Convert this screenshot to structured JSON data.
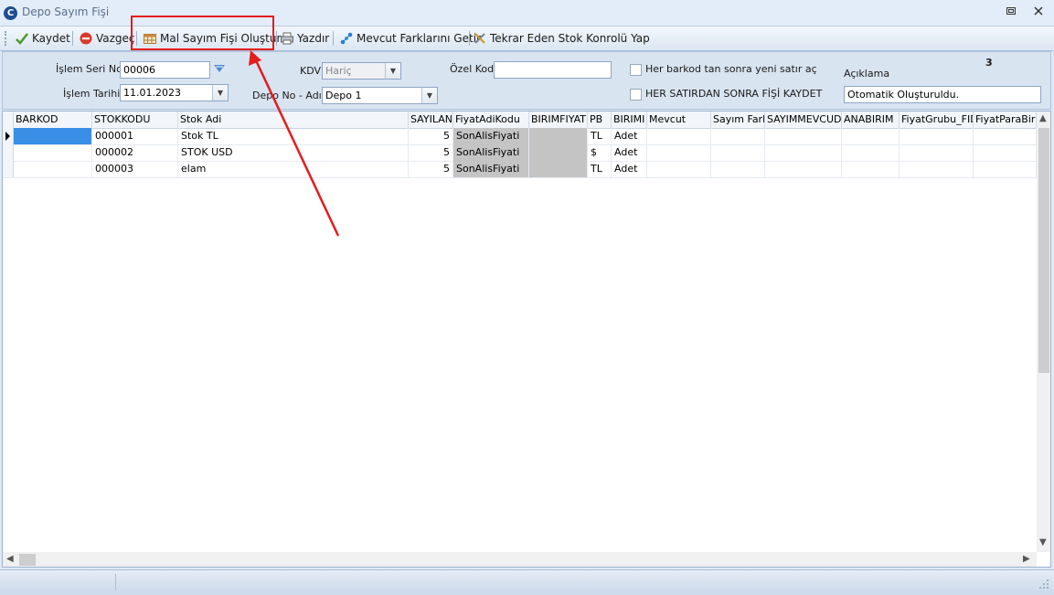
{
  "window": {
    "title": "Depo Sayım Fişi"
  },
  "toolbar": {
    "save_label": "Kaydet",
    "cancel_label": "Vazgeç",
    "create_slip_label": "Mal Sayım Fişi Oluştur",
    "print_label": "Yazdır",
    "fetch_diff_label": "Mevcut Farklarını Getir",
    "repeat_check_label": "Tekrar Eden Stok Konrolü Yap"
  },
  "form": {
    "seri_no_label": "İşlem Seri No",
    "seri_no_value": "00006",
    "tarih_label": "İşlem Tarihi",
    "tarih_value": "11.01.2023",
    "kdv_label": "KDV",
    "kdv_value": "Hariç",
    "depo_label": "Depo No - Adı",
    "depo_value": "Depo 1",
    "ozel_kod_label": "Özel Kod",
    "ozel_kod_value": "",
    "barkod_check_label": "Her barkod tan sonra yeni satır aç",
    "satir_check_label": "HER SATIRDAN SONRA FİŞİ KAYDET",
    "aciklama_label": "Açıklama",
    "aciklama_value": "Otomatik Oluşturuldu.",
    "count_value": "3"
  },
  "grid": {
    "columns": [
      "BARKOD",
      "STOKKODU",
      "Stok Adi",
      "SAYILAN",
      "FiyatAdiKodu",
      "BIRIMFIYAT",
      "PB",
      "BIRIMI",
      "Mevcut",
      "Sayım Farkı",
      "SAYIMMEVCUDU",
      "ANABIRIM",
      "FiyatGrubu_FID",
      "FiyatParaBirimi"
    ],
    "rows": [
      {
        "barkod": "",
        "stokkodu": "000001",
        "stokadi": "Stok TL",
        "sayilan": "5",
        "fiyatadikodu": "SonAlisFiyati",
        "birimfiyat": "",
        "pb": "TL",
        "birimi": "Adet"
      },
      {
        "barkod": "",
        "stokkodu": "000002",
        "stokadi": "STOK USD",
        "sayilan": "5",
        "fiyatadikodu": "SonAlisFiyati",
        "birimfiyat": "",
        "pb": "$",
        "birimi": "Adet"
      },
      {
        "barkod": "",
        "stokkodu": "000003",
        "stokadi": "elam",
        "sayilan": "5",
        "fiyatadikodu": "SonAlisFiyati",
        "birimfiyat": "",
        "pb": "TL",
        "birimi": "Adet"
      }
    ]
  },
  "colors": {
    "highlight": "#e51c1c",
    "annotation_arrow": "#e51c1c",
    "selected_cell": "#3a8ee6",
    "gray_cell": "#c4c4c4"
  }
}
